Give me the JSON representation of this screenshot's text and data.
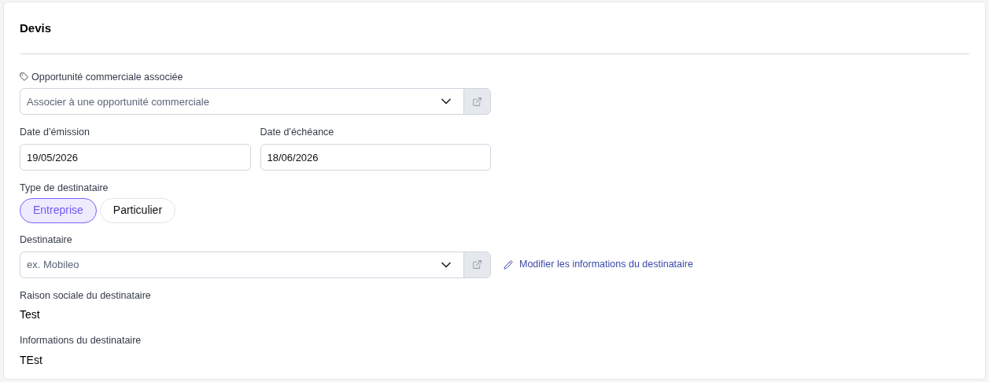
{
  "card": {
    "title": "Devis"
  },
  "opportunity": {
    "label": "Opportunité commerciale associée",
    "placeholder": "Associer à une opportunité commerciale"
  },
  "dates": [
    {
      "label": "Date d’émission",
      "value": "19/05/2026"
    },
    {
      "label": "Date d’échéance",
      "value": "18/06/2026"
    }
  ],
  "recipient_type": {
    "label": "Type de destinataire",
    "options": [
      {
        "label": "Entreprise",
        "selected": true
      },
      {
        "label": "Particulier",
        "selected": false
      }
    ]
  },
  "recipient": {
    "label": "Destinataire",
    "placeholder": "ex. Mobileo",
    "edit_link": "Modifier les informations du destinataire"
  },
  "details": [
    {
      "label": "Raison sociale du destinataire",
      "value": "Test"
    },
    {
      "label": "Informations du destinataire",
      "value": "TEst"
    }
  ]
}
